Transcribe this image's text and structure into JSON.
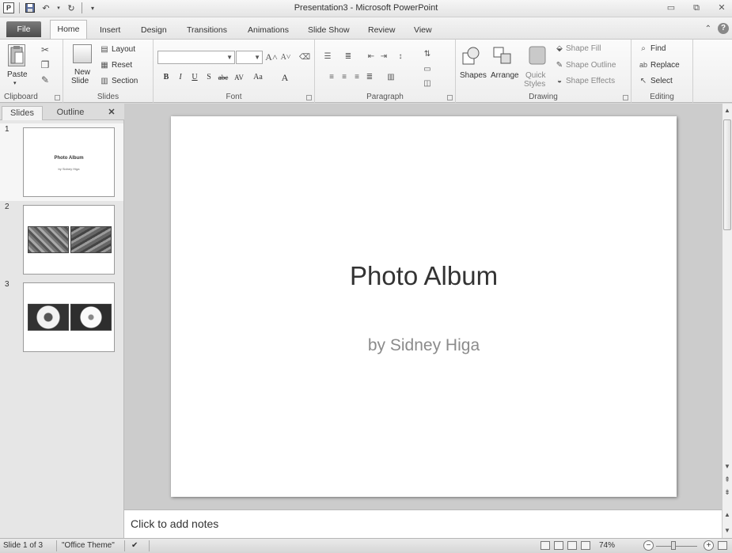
{
  "window": {
    "title": "Presentation3 - Microsoft PowerPoint",
    "app_icon_letter": "P"
  },
  "tabs": [
    "File",
    "Home",
    "Insert",
    "Design",
    "Transitions",
    "Animations",
    "Slide Show",
    "Review",
    "View"
  ],
  "active_tab": "Home",
  "ribbon": {
    "clipboard": {
      "label": "Clipboard",
      "paste": "Paste"
    },
    "slides": {
      "label": "Slides",
      "new_slide_1": "New",
      "new_slide_2": "Slide",
      "layout": "Layout",
      "reset": "Reset",
      "section": "Section"
    },
    "font": {
      "label": "Font",
      "font_name": "",
      "font_size": ""
    },
    "paragraph": {
      "label": "Paragraph"
    },
    "drawing": {
      "label": "Drawing",
      "shapes": "Shapes",
      "arrange": "Arrange",
      "quick_styles_1": "Quick",
      "quick_styles_2": "Styles",
      "shape_fill": "Shape Fill",
      "shape_outline": "Shape Outline",
      "shape_effects": "Shape Effects"
    },
    "editing": {
      "label": "Editing",
      "find": "Find",
      "replace": "Replace",
      "select": "Select"
    }
  },
  "panel": {
    "tab_slides": "Slides",
    "tab_outline": "Outline",
    "thumbnails": [
      {
        "number": "1",
        "title": "Photo Album",
        "subtitle": "by Sidney Higa"
      },
      {
        "number": "2"
      },
      {
        "number": "3"
      }
    ]
  },
  "slide": {
    "title": "Photo Album",
    "subtitle": "by Sidney Higa"
  },
  "notes": {
    "placeholder": "Click to add notes"
  },
  "status": {
    "slide_position": "Slide 1 of 3",
    "theme": "\"Office Theme\"",
    "zoom": "74%"
  }
}
